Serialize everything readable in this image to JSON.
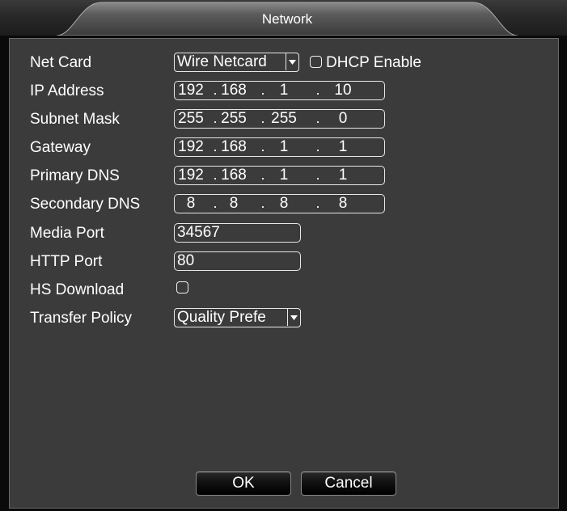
{
  "window": {
    "title": "Network"
  },
  "form": {
    "net_card": {
      "label": "Net Card",
      "value": "Wire Netcard"
    },
    "dhcp": {
      "label": "DHCP Enable",
      "checked": false
    },
    "ip_address": {
      "label": "IP Address",
      "octets": [
        "192",
        "168",
        "1",
        "10"
      ]
    },
    "subnet_mask": {
      "label": "Subnet Mask",
      "octets": [
        "255",
        "255",
        "255",
        "0"
      ]
    },
    "gateway": {
      "label": "Gateway",
      "octets": [
        "192",
        "168",
        "1",
        "1"
      ]
    },
    "primary_dns": {
      "label": "Primary DNS",
      "octets": [
        "192",
        "168",
        "1",
        "1"
      ]
    },
    "secondary_dns": {
      "label": "Secondary DNS",
      "octets": [
        "8",
        "8",
        "8",
        "8"
      ]
    },
    "media_port": {
      "label": "Media Port",
      "value": "34567"
    },
    "http_port": {
      "label": "HTTP Port",
      "value": "80"
    },
    "hs_download": {
      "label": "HS Download",
      "checked": false
    },
    "transfer_policy": {
      "label": "Transfer Policy",
      "value": "Quality Prefe"
    }
  },
  "buttons": {
    "ok": "OK",
    "cancel": "Cancel"
  },
  "icons": {
    "dropdown": "chevron-down-icon",
    "checkbox": "checkbox-icon"
  }
}
